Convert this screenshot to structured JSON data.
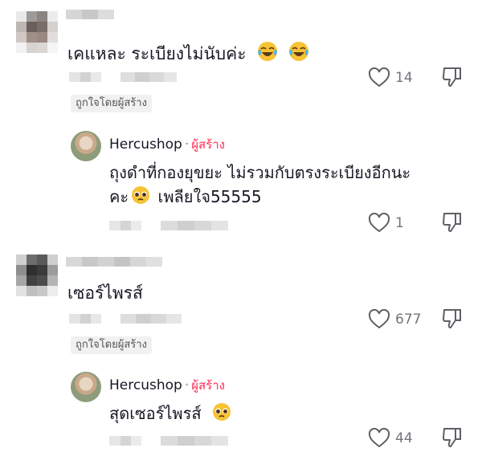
{
  "colors": {
    "creator_accent": "#fe2c55",
    "text": "#161823",
    "muted": "#73747b",
    "badge_bg": "#f1f1f2"
  },
  "comments": [
    {
      "text": "เคแหละ ระเบียงไม่นับค่ะ",
      "emoji": [
        "face-with-tears-of-joy",
        "face-with-tears-of-joy"
      ],
      "likes": "14",
      "creator_liked": "ถูกใจโดยผู้สร้าง",
      "reply": {
        "author": "Hercushop",
        "separator": "·",
        "creator_tag": "ผู้สร้าง",
        "line1": "ถุงดำที่กองยุขยะ ไม่รวมกับตรงระเบียงอีกนะ",
        "line2_pre": "คะ",
        "line2_post": " เพลียใจ55555",
        "emoji": "pleading-face",
        "likes": "1"
      }
    },
    {
      "text": "เซอร์ไพรส์",
      "likes": "677",
      "creator_liked": "ถูกใจโดยผู้สร้าง",
      "reply": {
        "author": "Hercushop",
        "separator": "·",
        "creator_tag": "ผู้สร้าง",
        "line1": "สุดเซอร์ไพรส์",
        "emoji": "pleading-face",
        "likes": "44"
      }
    }
  ],
  "icons": {
    "like": "heart-outline-icon",
    "dislike": "thumbs-down-icon"
  }
}
